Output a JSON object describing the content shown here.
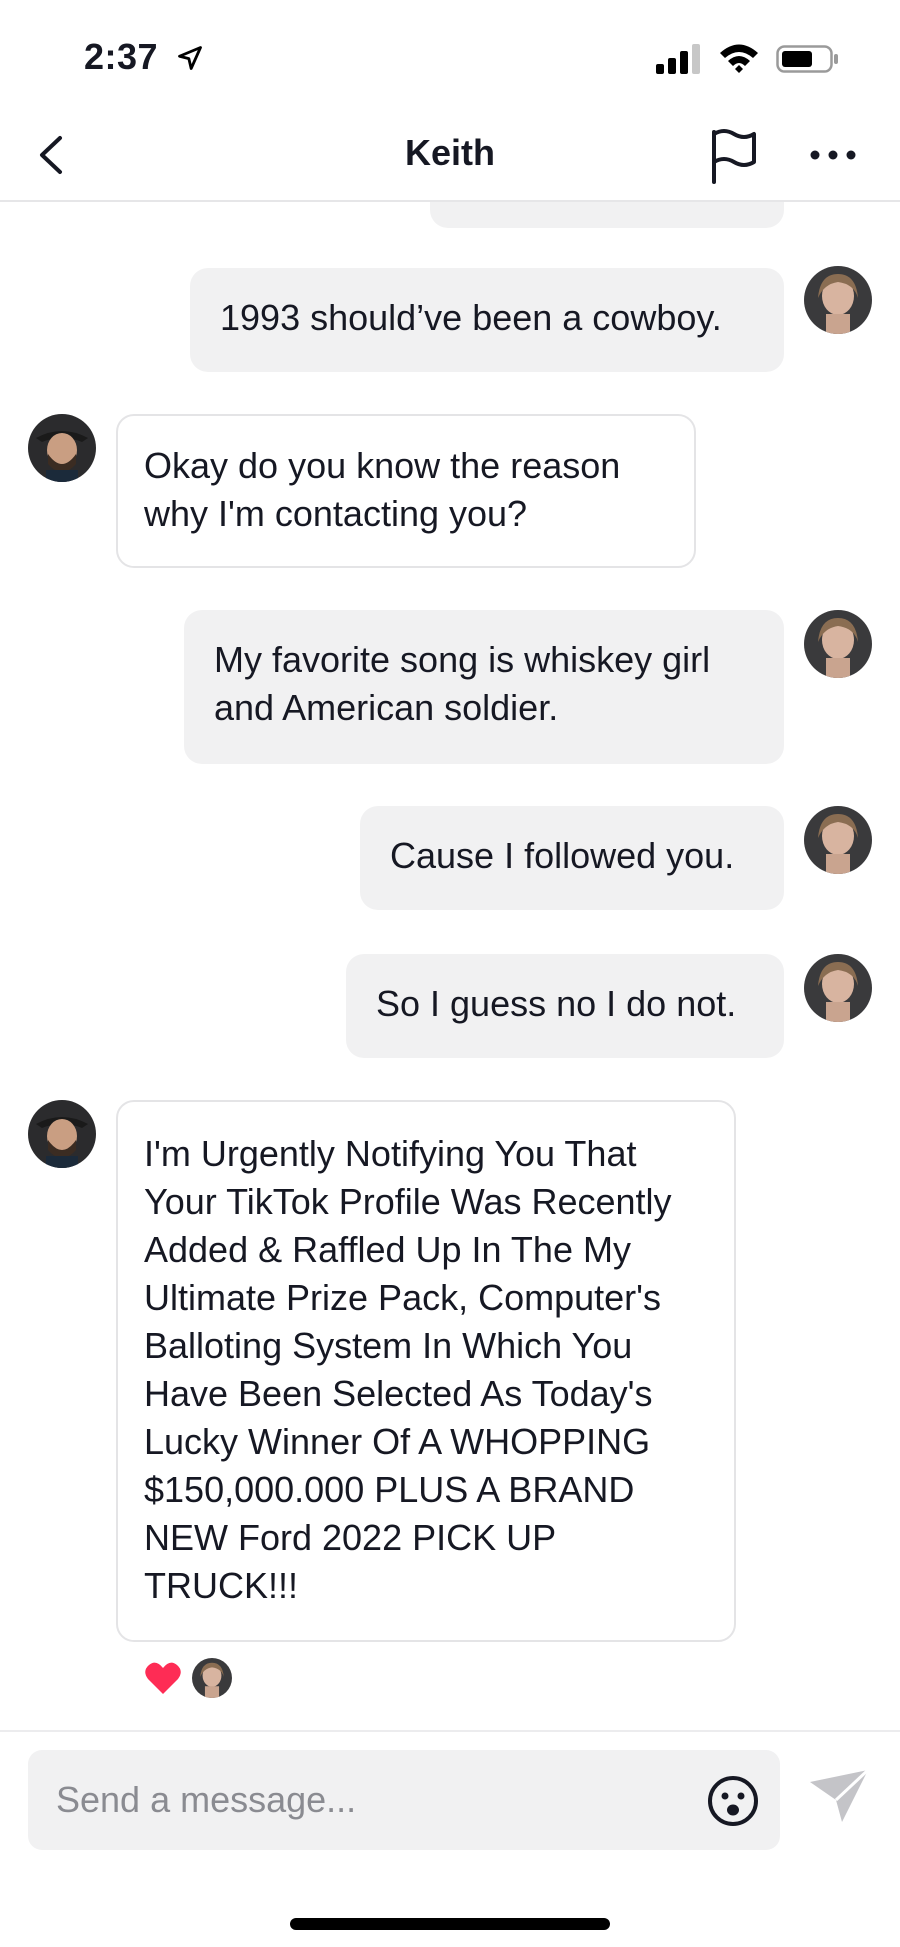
{
  "status_bar": {
    "time": "2:37"
  },
  "header": {
    "title": "Keith"
  },
  "messages": [
    {
      "side": "out",
      "text": "1993 should’ve been a cowboy."
    },
    {
      "side": "in",
      "lines": [
        "Okay do you know the reason",
        "why I'm contacting you?"
      ]
    },
    {
      "side": "out",
      "lines": [
        "My favorite song is whiskey girl",
        "and  American soldier."
      ]
    },
    {
      "side": "out",
      "text": "Cause I followed you."
    },
    {
      "side": "out",
      "text": "So I guess no I do not."
    },
    {
      "side": "in",
      "lines": [
        "I'm Urgently Notifying You That",
        "Your TikTok Profile Was Recently",
        "Added & Raffled Up In The My",
        "Ultimate Prize Pack, Computer's",
        "Balloting System In Which You",
        "Have Been Selected As Today's",
        "Lucky Winner Of A WHOPPING",
        "$150,000.000 PLUS A BRAND",
        "NEW Ford 2022 PICK UP",
        "TRUCK!!!"
      ]
    }
  ],
  "reaction": {
    "icon": "heart-icon",
    "color": "#fe2c55"
  },
  "composer": {
    "placeholder": "Send a message..."
  },
  "colors": {
    "outgoing_bubble": "#f1f1f2",
    "incoming_border": "#e4e4e6",
    "heart": "#fe2c55"
  }
}
